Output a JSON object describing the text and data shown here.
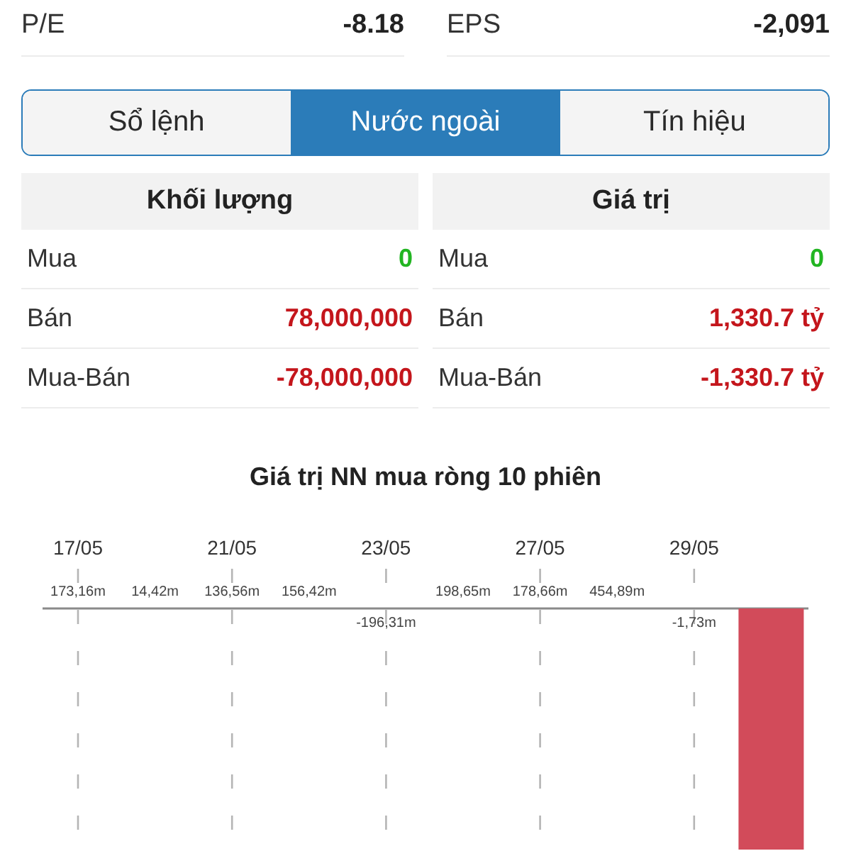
{
  "stats": [
    {
      "label": "P/E",
      "value": "-8.18"
    },
    {
      "label": "EPS",
      "value": "-2,091"
    }
  ],
  "tabs": [
    {
      "label": "Sổ lệnh",
      "selected": false
    },
    {
      "label": "Nước ngoài",
      "selected": true
    },
    {
      "label": "Tín hiệu",
      "selected": false
    }
  ],
  "tables": [
    {
      "title": "Khối lượng",
      "rows": [
        {
          "label": "Mua",
          "value": "0",
          "color": "#22b522"
        },
        {
          "label": "Bán",
          "value": "78,000,000",
          "color": "#c4161c"
        },
        {
          "label": "Mua-Bán",
          "value": "-78,000,000",
          "color": "#c4161c"
        }
      ]
    },
    {
      "title": "Giá trị",
      "rows": [
        {
          "label": "Mua",
          "value": "0",
          "color": "#22b522"
        },
        {
          "label": "Bán",
          "value": "1,330.7 tỷ",
          "color": "#c4161c"
        },
        {
          "label": "Mua-Bán",
          "value": "-1,330.7 tỷ",
          "color": "#c4161c"
        }
      ]
    }
  ],
  "chart": {
    "chart_data": {
      "type": "bar",
      "title": "Giá trị NN mua ròng 10 phiên",
      "categories": [
        "17/05",
        null,
        "21/05",
        null,
        "23/05",
        null,
        "27/05",
        null,
        "29/05",
        null
      ],
      "values": [
        173.16,
        14.42,
        136.56,
        156.42,
        -196.31,
        198.65,
        178.66,
        454.89,
        -1.73,
        -1330700
      ],
      "grid": true,
      "value_labels": [
        "173,16m",
        "14,42m",
        "136,56m",
        "156,42m",
        "-196,31m",
        "198,65m",
        "178,66m",
        "454,89m",
        "-1,73m",
        null
      ]
    }
  }
}
